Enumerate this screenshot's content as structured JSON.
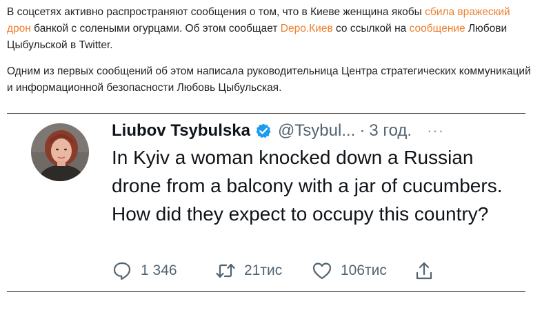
{
  "article": {
    "p1": {
      "t1": "В соцсетях активно распространяют сообщения о том, что в Киеве женщина якобы ",
      "link1": "сбила вражеский дрон",
      "t2": " банкой с солеными огурцами. Об этом сообщает ",
      "link2": "Depo.Киев",
      "t3": " со ссылкой на ",
      "link3": "сообщение",
      "t4": " Любови Цыбульской в Twitter."
    },
    "p2": "Одним из первых сообщений об этом написала руководительница Центра стратегических коммуникаций и информационной безопасности Любовь Цыбульская."
  },
  "tweet": {
    "author_name": "Liubov Tsybulska",
    "handle": "@Tsybul...",
    "separator": "·",
    "time": "3 год.",
    "more": "···",
    "text": "In Kyiv a woman knocked down a Russian drone from a balcony with a jar of cucumbers. How did they expect to occupy this country?",
    "replies": "1 346",
    "retweets": "21тис",
    "likes": "106тис"
  },
  "icons": {
    "verified": "verified-badge-icon",
    "reply": "reply-icon",
    "retweet": "retweet-icon",
    "like": "heart-icon",
    "share": "share-icon"
  },
  "colors": {
    "link": "#ef7e2e",
    "verified": "#1d9bf0",
    "muted": "#536471",
    "text": "#0f1419"
  }
}
